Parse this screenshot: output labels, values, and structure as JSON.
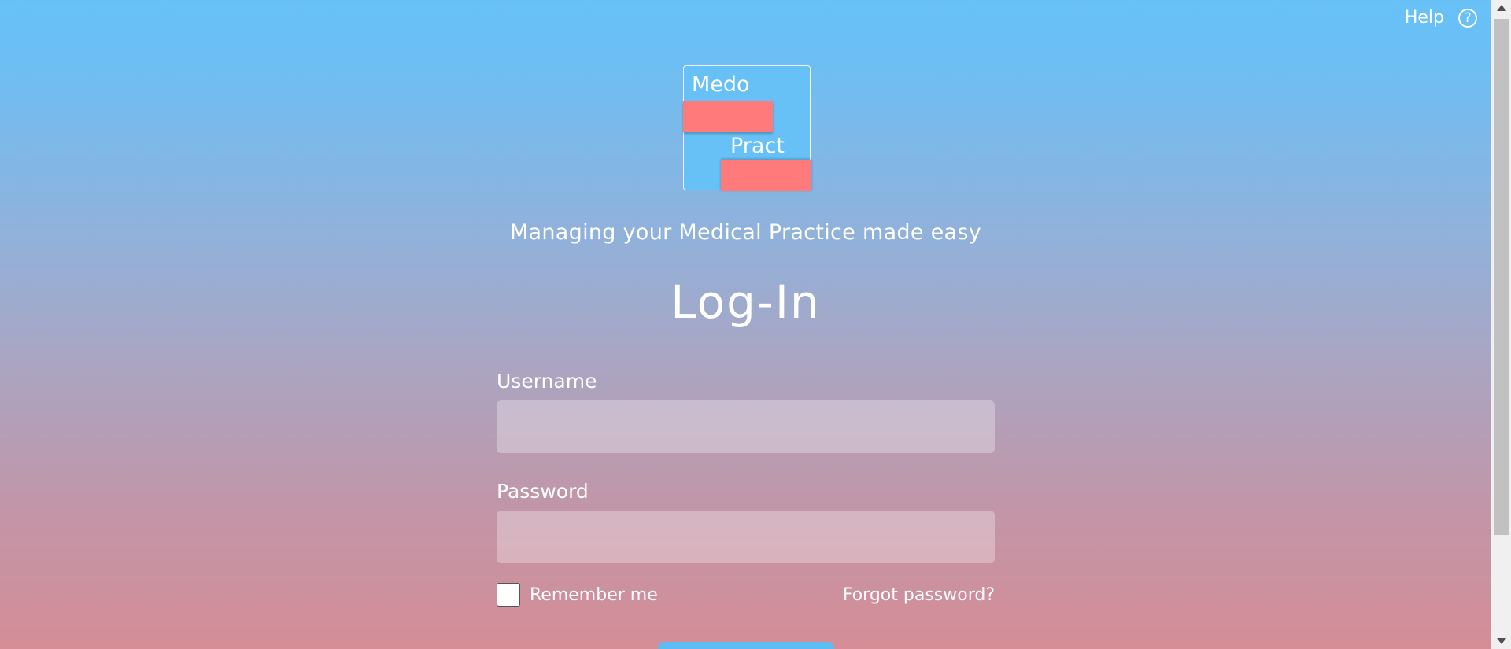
{
  "header": {
    "help_label": "Help",
    "help_icon": "?"
  },
  "logo": {
    "top_text": "Medo",
    "bottom_text": "Pract"
  },
  "tagline": "Managing your Medical Practice made easy",
  "title": "Log-In",
  "form": {
    "username_label": "Username",
    "username_value": "",
    "password_label": "Password",
    "password_value": "",
    "remember_label": "Remember me",
    "remember_checked": false,
    "forgot_label": "Forgot password?"
  },
  "colors": {
    "gradient_top": "#67c1f7",
    "gradient_bottom": "#d58d96",
    "logo_accent": "#ff7b7b",
    "button": "#5bbdf4"
  }
}
